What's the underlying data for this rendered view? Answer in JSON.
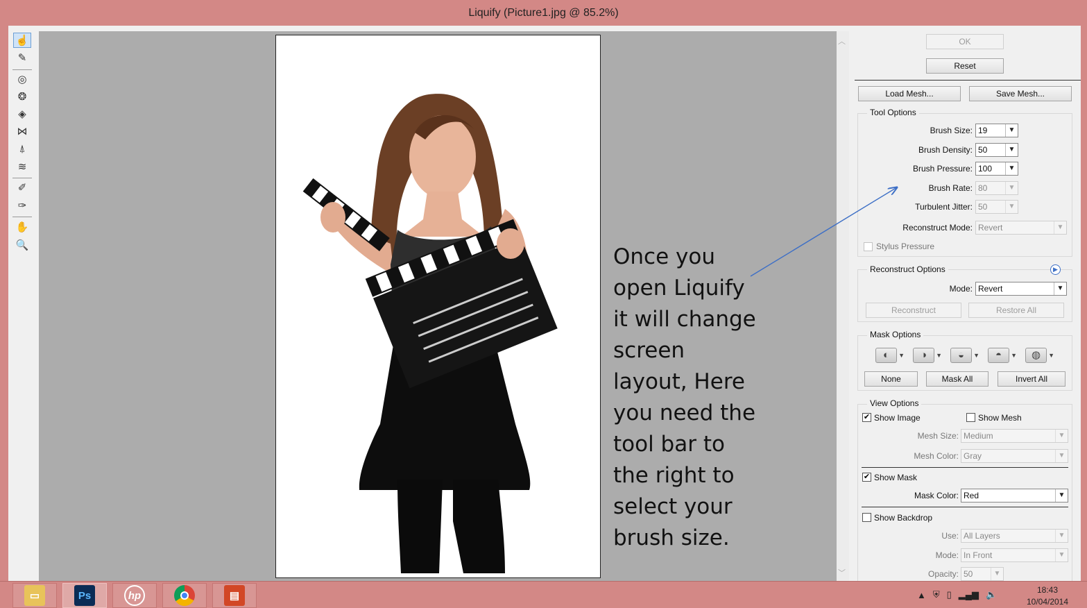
{
  "window": {
    "title": "Liquify (Picture1.jpg @ 85.2%)"
  },
  "tools": [
    {
      "name": "forward-warp-tool-icon",
      "glyph": "☝"
    },
    {
      "name": "reconstruct-tool-icon",
      "glyph": "✎"
    },
    {
      "name": "twirl-clockwise-tool-icon",
      "glyph": "◎"
    },
    {
      "name": "pucker-tool-icon",
      "glyph": "❂"
    },
    {
      "name": "bloat-tool-icon",
      "glyph": "◈"
    },
    {
      "name": "push-left-tool-icon",
      "glyph": "⋈"
    },
    {
      "name": "mirror-tool-icon",
      "glyph": "⍋"
    },
    {
      "name": "turbulence-tool-icon",
      "glyph": "≋"
    },
    {
      "name": "freeze-mask-tool-icon",
      "glyph": "✐"
    },
    {
      "name": "thaw-mask-tool-icon",
      "glyph": "✑"
    },
    {
      "name": "hand-tool-icon",
      "glyph": "✋"
    },
    {
      "name": "zoom-tool-icon",
      "glyph": "🔍"
    }
  ],
  "annotation": "Once you\nopen Liquify\nit will change\nscreen\nlayout, Here\nyou need the\ntool bar to\nthe right to\nselect your\nbrush size.",
  "panel": {
    "ok": "OK",
    "reset": "Reset",
    "load_mesh": "Load Mesh...",
    "save_mesh": "Save Mesh...",
    "tool_options": {
      "title": "Tool Options",
      "brush_size_label": "Brush Size:",
      "brush_size": "19",
      "brush_density_label": "Brush Density:",
      "brush_density": "50",
      "brush_pressure_label": "Brush Pressure:",
      "brush_pressure": "100",
      "brush_rate_label": "Brush Rate:",
      "brush_rate": "80",
      "turbulent_jitter_label": "Turbulent Jitter:",
      "turbulent_jitter": "50",
      "reconstruct_mode_label": "Reconstruct Mode:",
      "reconstruct_mode": "Revert",
      "stylus_pressure": "Stylus Pressure"
    },
    "reconstruct_options": {
      "title": "Reconstruct Options",
      "mode_label": "Mode:",
      "mode": "Revert",
      "reconstruct": "Reconstruct",
      "restore_all": "Restore All"
    },
    "mask_options": {
      "title": "Mask Options",
      "none": "None",
      "mask_all": "Mask All",
      "invert_all": "Invert All"
    },
    "view_options": {
      "title": "View Options",
      "show_image": "Show Image",
      "show_image_checked": true,
      "show_mesh": "Show Mesh",
      "show_mesh_checked": false,
      "mesh_size_label": "Mesh Size:",
      "mesh_size": "Medium",
      "mesh_color_label": "Mesh Color:",
      "mesh_color": "Gray",
      "show_mask": "Show Mask",
      "show_mask_checked": true,
      "mask_color_label": "Mask Color:",
      "mask_color": "Red",
      "show_backdrop": "Show Backdrop",
      "show_backdrop_checked": false,
      "use_label": "Use:",
      "use": "All Layers",
      "mode_label": "Mode:",
      "mode": "In Front",
      "opacity_label": "Opacity:",
      "opacity": "50"
    }
  },
  "taskbar": {
    "apps": [
      {
        "name": "file-explorer",
        "label": ""
      },
      {
        "name": "photoshop",
        "label": "Ps"
      },
      {
        "name": "hp",
        "label": "hp"
      },
      {
        "name": "chrome",
        "label": ""
      },
      {
        "name": "powerpoint",
        "label": ""
      }
    ],
    "time": "18:43",
    "date": "10/04/2014"
  },
  "colors": {
    "titlebar": "#d38886",
    "accent": "#3d6fc6",
    "canvas": "#acacac"
  }
}
